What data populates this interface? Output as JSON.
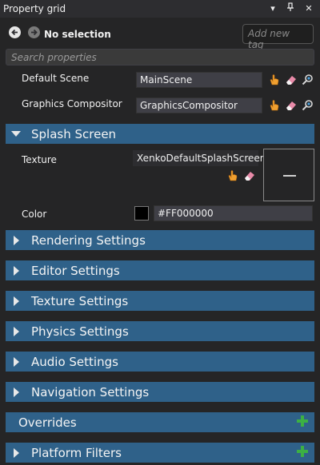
{
  "window": {
    "title": "Property grid",
    "controls": [
      "▾",
      "⊥",
      "✕"
    ]
  },
  "toolbar": {
    "selection": "No selection",
    "tag_placeholder": "Add new tag"
  },
  "search": {
    "placeholder": "Search properties"
  },
  "properties": {
    "default_scene": {
      "label": "Default Scene",
      "value": "MainScene"
    },
    "graphics_compositor": {
      "label": "Graphics Compositor",
      "value": "GraphicsCompositor"
    }
  },
  "splash": {
    "title": "Splash Screen",
    "texture_label": "Texture",
    "texture_value": "XenkoDefaultSplashScreen",
    "color_label": "Color",
    "color_value": "#FF000000",
    "swatch_color": "#000000"
  },
  "sections": [
    {
      "label": "Rendering Settings"
    },
    {
      "label": "Editor Settings"
    },
    {
      "label": "Texture Settings"
    },
    {
      "label": "Physics Settings"
    },
    {
      "label": "Audio Settings"
    },
    {
      "label": "Navigation Settings"
    }
  ],
  "overrides": {
    "label": "Overrides"
  },
  "platform_filters": {
    "label": "Platform Filters"
  },
  "colors": {
    "section_bg": "#2f6189",
    "accent_green": "#3cb043",
    "hand_orange": "#f0a030",
    "eraser_pink": "#e88aa8"
  }
}
